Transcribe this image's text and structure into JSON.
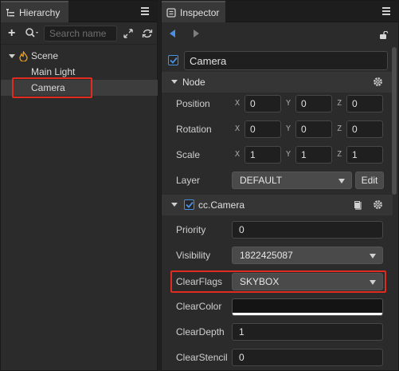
{
  "hierarchy": {
    "tab_label": "Hierarchy",
    "search_placeholder": "Search name",
    "tree": [
      {
        "label": "Scene",
        "selected": false
      },
      {
        "label": "Main Light",
        "selected": false
      },
      {
        "label": "Camera",
        "selected": true
      }
    ]
  },
  "inspector": {
    "tab_label": "Inspector",
    "node_name": "Camera",
    "node_section": {
      "title": "Node",
      "position": {
        "x": "0",
        "y": "0",
        "z": "0"
      },
      "rotation": {
        "x": "0",
        "y": "0",
        "z": "0"
      },
      "scale": {
        "x": "1",
        "y": "1",
        "z": "1"
      },
      "labels": {
        "position": "Position",
        "rotation": "Rotation",
        "scale": "Scale",
        "layer": "Layer"
      },
      "layer_value": "DEFAULT",
      "edit_label": "Edit"
    },
    "axis_labels": {
      "x": "X",
      "y": "Y",
      "z": "Z"
    },
    "camera_section": {
      "title": "cc.Camera",
      "labels": {
        "priority": "Priority",
        "visibility": "Visibility",
        "clear_flags": "ClearFlags",
        "clear_color": "ClearColor",
        "clear_depth": "ClearDepth",
        "clear_stencil": "ClearStencil"
      },
      "priority": "0",
      "visibility": "1822425087",
      "clear_flags": "SKYBOX",
      "clear_color_hex": "#141414",
      "clear_depth": "1",
      "clear_stencil": "0"
    }
  },
  "colors": {
    "accent": "#4a90e2",
    "highlight": "#e02b20",
    "scene_icon": "#f0a020"
  },
  "icons": [
    "hierarchy-icon",
    "menu-icon",
    "plus-icon",
    "search-icon",
    "expand-icon",
    "refresh-icon",
    "scene-icon",
    "inspector-icon",
    "back-icon",
    "forward-icon",
    "lock-icon",
    "checkbox-icon",
    "gear-icon",
    "book-icon",
    "chevron-down-icon"
  ]
}
